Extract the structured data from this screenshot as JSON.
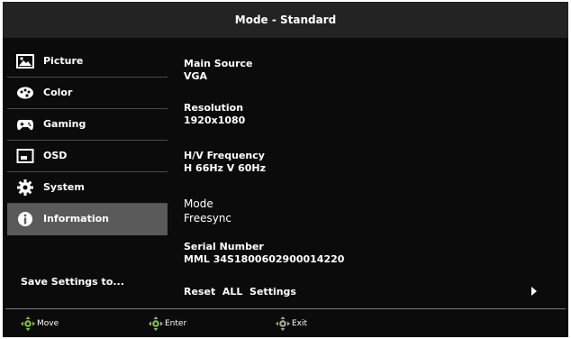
{
  "title": "Mode - Standard",
  "sidebar": {
    "items": [
      {
        "label": "Picture",
        "icon": "picture-icon"
      },
      {
        "label": "Color",
        "icon": "palette-icon"
      },
      {
        "label": "Gaming",
        "icon": "gamepad-icon"
      },
      {
        "label": "OSD",
        "icon": "osd-window-icon"
      },
      {
        "label": "System",
        "icon": "gear-icon"
      },
      {
        "label": "Information",
        "icon": "info-icon",
        "active": true
      }
    ],
    "save_settings": "Save Settings to..."
  },
  "info": {
    "main_source": {
      "label": "Main Source",
      "value": "VGA"
    },
    "resolution": {
      "label": "Resolution",
      "value": "1920x1080"
    },
    "hv_frequency": {
      "label": "H/V Frequency",
      "value": "H 66Hz  V 60Hz"
    },
    "mode": {
      "label": "Mode",
      "value": "Freesync"
    },
    "serial_number": {
      "label": "Serial Number",
      "value": "MML 34S1800602900014220"
    }
  },
  "reset": {
    "label": "Reset  ALL  Settings"
  },
  "footer": {
    "move": "Move",
    "enter": "Enter",
    "exit": "Exit"
  },
  "colors": {
    "background": "#0b0b0b",
    "titlebar": "#232323",
    "active_item": "#5a5a5a",
    "dpad_accent": "#7dc242"
  }
}
